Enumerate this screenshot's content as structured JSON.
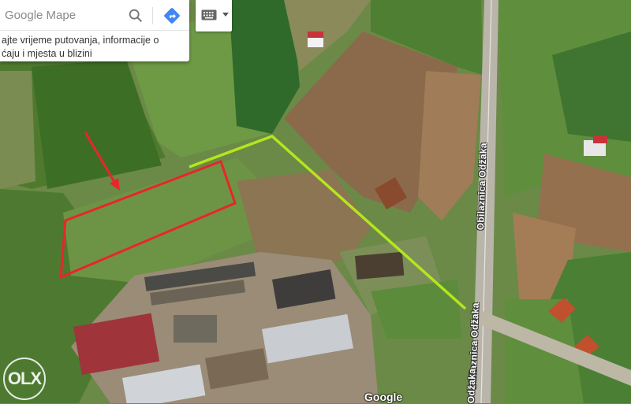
{
  "search": {
    "placeholder": "Google Mape",
    "hint_line1": "ajte vrijeme putovanja, informacije o",
    "hint_line2": "ćaju i mjesta u blizini"
  },
  "icons": {
    "search": "search-icon",
    "directions": "directions-icon",
    "keyboard": "keyboard-icon",
    "dropdown": "chevron-down-icon"
  },
  "map": {
    "road_labels": [
      "Obilaznica Odžaka",
      "Obilaznica Odžaka",
      "Odžaka"
    ],
    "attribution": "Google",
    "watermark": "OLX"
  },
  "colors": {
    "boundary": "#e8262a",
    "route_line": "#b5e61d",
    "arrow": "#e8262a",
    "accent_blue": "#4285f4"
  }
}
